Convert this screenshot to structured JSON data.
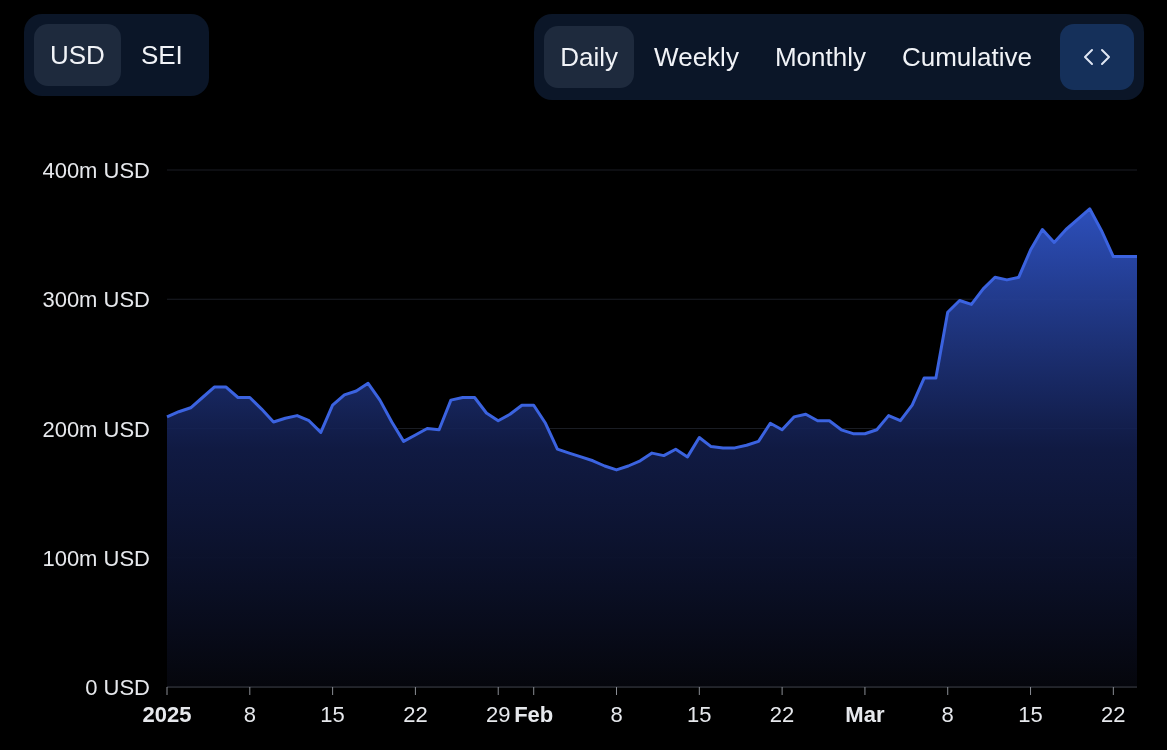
{
  "currency_toggle": [
    {
      "label": "USD",
      "selected": true
    },
    {
      "label": "SEI",
      "selected": false
    }
  ],
  "period_toggle": [
    {
      "label": "Daily",
      "selected": true
    },
    {
      "label": "Weekly",
      "selected": false
    },
    {
      "label": "Monthly",
      "selected": false
    },
    {
      "label": "Cumulative",
      "selected": false
    }
  ],
  "chart_data": {
    "type": "area",
    "categories": [
      "**2025**",
      null,
      null,
      null,
      null,
      null,
      null,
      "8",
      null,
      null,
      null,
      null,
      null,
      null,
      "15",
      null,
      null,
      null,
      null,
      null,
      null,
      "22",
      null,
      null,
      null,
      null,
      null,
      null,
      "29",
      null,
      null,
      "**Feb**",
      null,
      null,
      null,
      null,
      null,
      null,
      "8",
      null,
      null,
      null,
      null,
      null,
      null,
      "15",
      null,
      null,
      null,
      null,
      null,
      null,
      "22",
      null,
      null,
      null,
      null,
      null,
      null,
      "**Mar**",
      null,
      null,
      null,
      null,
      null,
      null,
      "8",
      null,
      null,
      null,
      null,
      null,
      null,
      "15",
      null,
      null,
      null,
      null,
      null,
      null,
      "22",
      null,
      null
    ],
    "series": [
      {
        "color": "#3b63e0",
        "values": [
          209,
          213,
          216,
          224,
          232,
          232,
          224,
          224,
          215,
          205,
          208,
          210,
          206,
          197,
          218,
          226,
          229,
          235,
          222,
          205,
          190,
          195,
          200,
          199,
          222,
          224,
          224,
          212,
          206,
          211,
          218,
          218,
          204,
          184,
          181,
          178,
          175,
          171,
          168,
          171,
          175,
          181,
          179,
          184,
          178,
          193,
          186,
          185,
          185,
          187,
          190,
          204,
          199,
          209,
          211,
          206,
          206,
          199,
          196,
          196,
          199,
          210,
          206,
          218,
          239,
          239,
          290,
          299,
          296,
          308,
          317,
          315,
          317,
          338,
          354,
          344,
          354,
          362,
          370,
          353,
          333,
          333,
          333
        ]
      }
    ],
    "ylim": [
      0,
      400
    ],
    "yticks": [
      {
        "value": 0,
        "label": "0 USD"
      },
      {
        "value": 100,
        "label": "100m USD"
      },
      {
        "value": 200,
        "label": "200m USD"
      },
      {
        "value": 300,
        "label": "300m USD"
      },
      {
        "value": 400,
        "label": "400m USD"
      }
    ]
  }
}
